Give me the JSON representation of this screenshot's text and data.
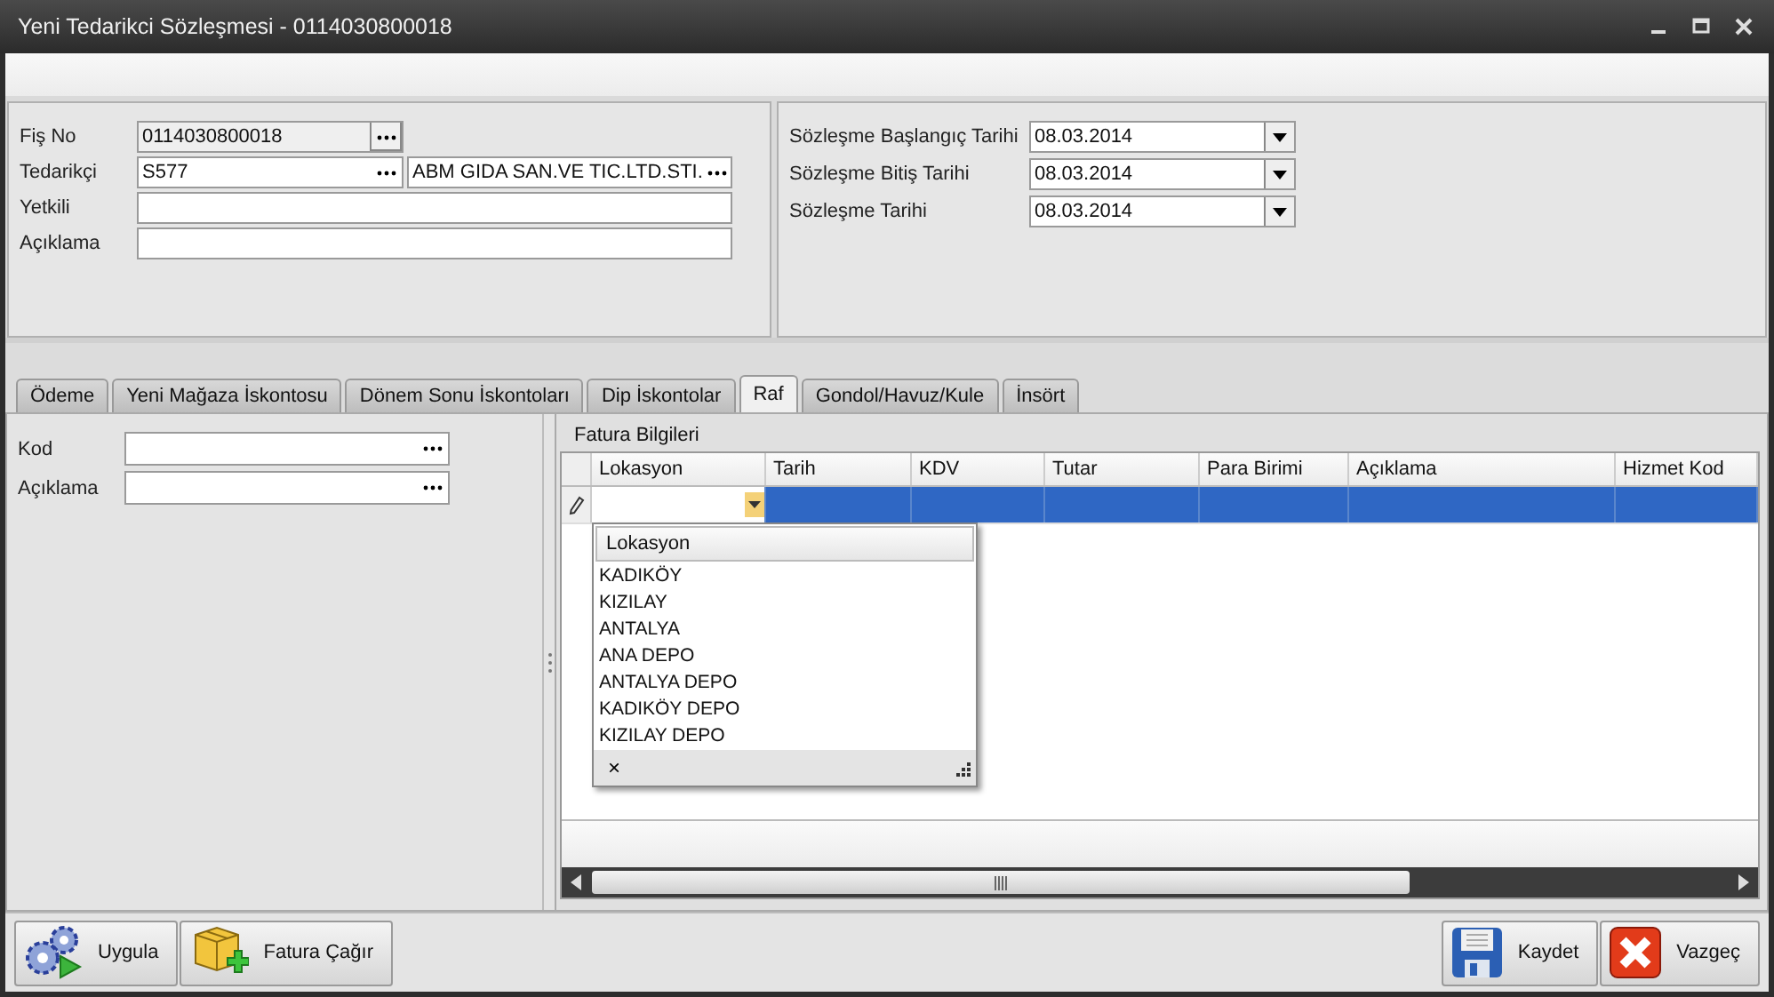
{
  "window": {
    "title": "Yeni Tedarikci Sözleşmesi - 0114030800018"
  },
  "header_left": {
    "fields": [
      {
        "label": "Fiş No",
        "kind": "lookup",
        "values": [
          "0114030800018"
        ],
        "readonly": true
      },
      {
        "label": "Tedarikçi",
        "kind": "double_lookup",
        "values": [
          "S577",
          "ABM GIDA SAN.VE TIC.LTD.STI."
        ],
        "readonly": false
      },
      {
        "label": "Yetkili",
        "kind": "text",
        "readonly": false
      },
      {
        "label": "Açıklama",
        "kind": "text",
        "readonly": false
      }
    ]
  },
  "header_right": {
    "fields": [
      {
        "label": "Sözleşme Başlangıç Tarihi",
        "value": "08.03.2014"
      },
      {
        "label": "Sözleşme Bitiş Tarihi",
        "value": "08.03.2014"
      },
      {
        "label": "Sözleşme Tarihi",
        "value": "08.03.2014"
      }
    ]
  },
  "tabs": [
    {
      "label": "Ödeme",
      "selected": false
    },
    {
      "label": "Yeni Mağaza İskontosu",
      "selected": false
    },
    {
      "label": "Dönem Sonu İskontoları",
      "selected": false
    },
    {
      "label": "Dip İskontolar",
      "selected": false
    },
    {
      "label": "Raf",
      "selected": true
    },
    {
      "label": "Gondol/Havuz/Kule",
      "selected": false
    },
    {
      "label": "İnsört",
      "selected": false
    }
  ],
  "filter": {
    "fields": [
      {
        "label": "Kod"
      },
      {
        "label": "Açıklama"
      }
    ]
  },
  "grid": {
    "title": "Fatura Bilgileri",
    "columns": [
      "Lokasyon",
      "Tarih",
      "KDV",
      "Tutar",
      "Para Birimi",
      "Açıklama",
      "Hizmet Kod"
    ],
    "rows": [
      {
        "selected": true
      }
    ],
    "dropdown": {
      "header": "Lokasyon",
      "items": [
        "KADIKÖY",
        "KIZILAY",
        "ANTALYA",
        "ANA DEPO",
        "ANTALYA DEPO",
        "KADIKÖY DEPO",
        "KIZILAY DEPO"
      ],
      "close": "×"
    }
  },
  "buttons_left": [
    {
      "label": "Uygula",
      "kind": "gears"
    },
    {
      "label": "Fatura Çağır",
      "kind": "boxes"
    }
  ],
  "buttons_right": [
    {
      "label": "Kaydet",
      "kind": "save"
    },
    {
      "label": "Vazgeç",
      "kind": "cancel"
    }
  ]
}
